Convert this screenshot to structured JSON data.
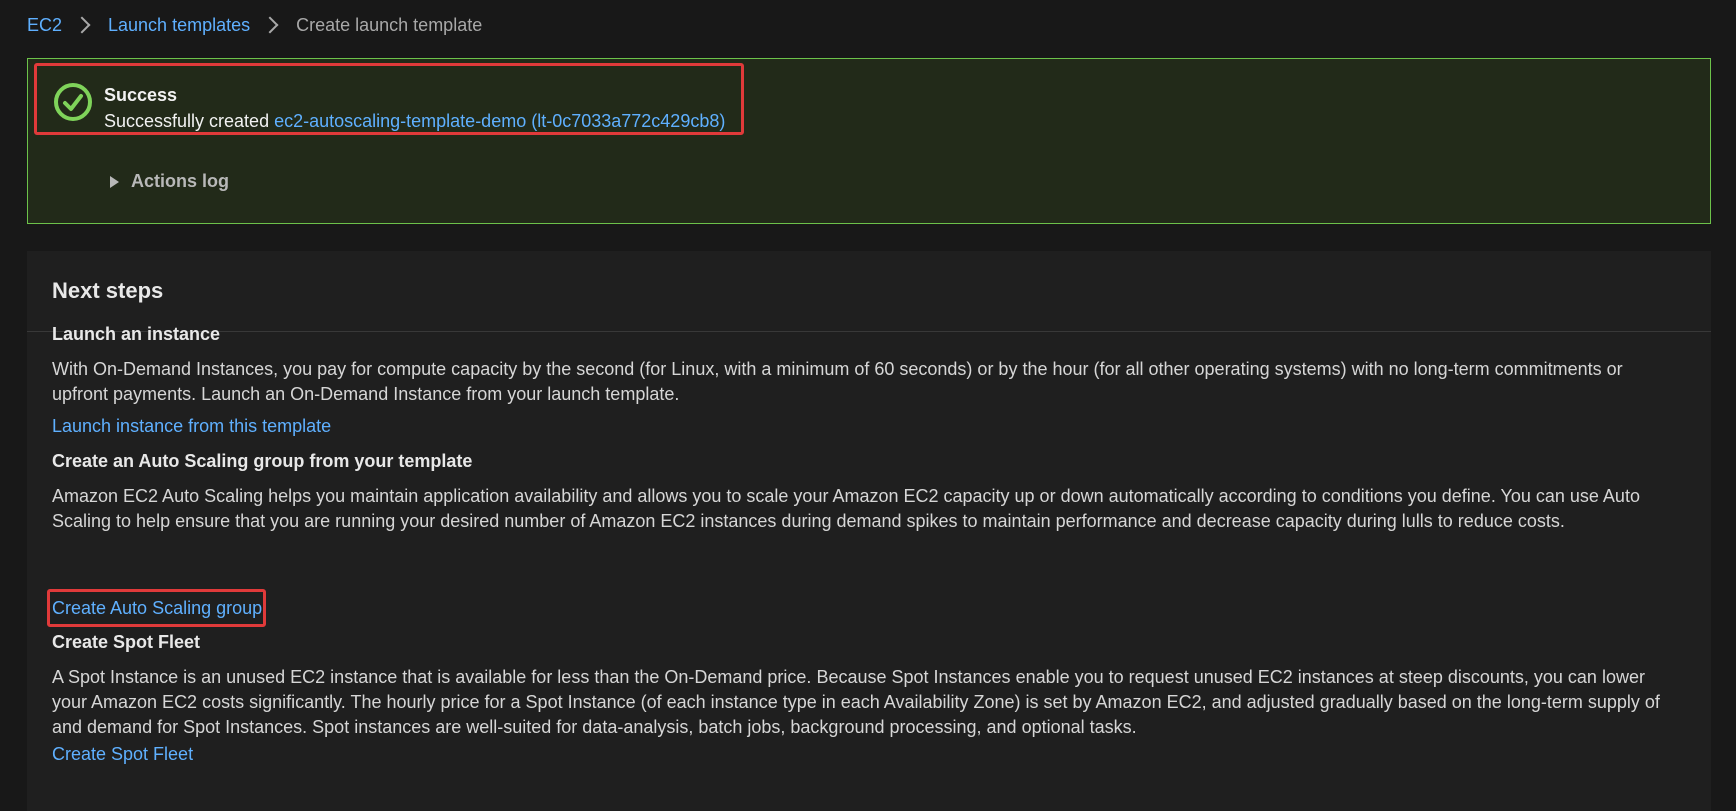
{
  "breadcrumb": {
    "items": [
      "EC2",
      "Launch templates"
    ],
    "current": "Create launch template"
  },
  "flash": {
    "title": "Success",
    "message_prefix": "Successfully created ",
    "template_link": "ec2-autoscaling-template-demo (lt-0c7033a772c429cb8)",
    "actions_log": "Actions log",
    "icon": "check-circle-icon",
    "status_color": "#6cc24a"
  },
  "next_steps": {
    "title": "Next steps",
    "sections": [
      {
        "title": "Launch an instance",
        "body": "With On-Demand Instances, you pay for compute capacity by the second (for Linux, with a minimum of 60 seconds) or by the hour (for all other operating systems) with no long-term commitments or upfront payments. Launch an On-Demand Instance from your launch template.",
        "link": "Launch instance from this template"
      },
      {
        "title": "Create an Auto Scaling group from your template",
        "body": "Amazon EC2 Auto Scaling helps you maintain application availability and allows you to scale your Amazon EC2 capacity up or down automatically according to conditions you define. You can use Auto Scaling to help ensure that you are running your desired number of Amazon EC2 instances during demand spikes to maintain performance and decrease capacity during lulls to reduce costs.",
        "link": "Create Auto Scaling group"
      },
      {
        "title": "Create Spot Fleet",
        "body": "A Spot Instance is an unused EC2 instance that is available for less than the On-Demand price. Because Spot Instances enable you to request unused EC2 instances at steep discounts, you can lower your Amazon EC2 costs significantly. The hourly price for a Spot Instance (of each instance type in each Availability Zone) is set by Amazon EC2, and adjusted gradually based on the long-term supply of and demand for Spot Instances. Spot instances are well-suited for data-analysis, batch jobs, background processing, and optional tasks.",
        "link": "Create Spot Fleet"
      }
    ]
  },
  "colors": {
    "link": "#5fb0ff",
    "highlight_box": "#e03a3a",
    "background": "#181818"
  }
}
